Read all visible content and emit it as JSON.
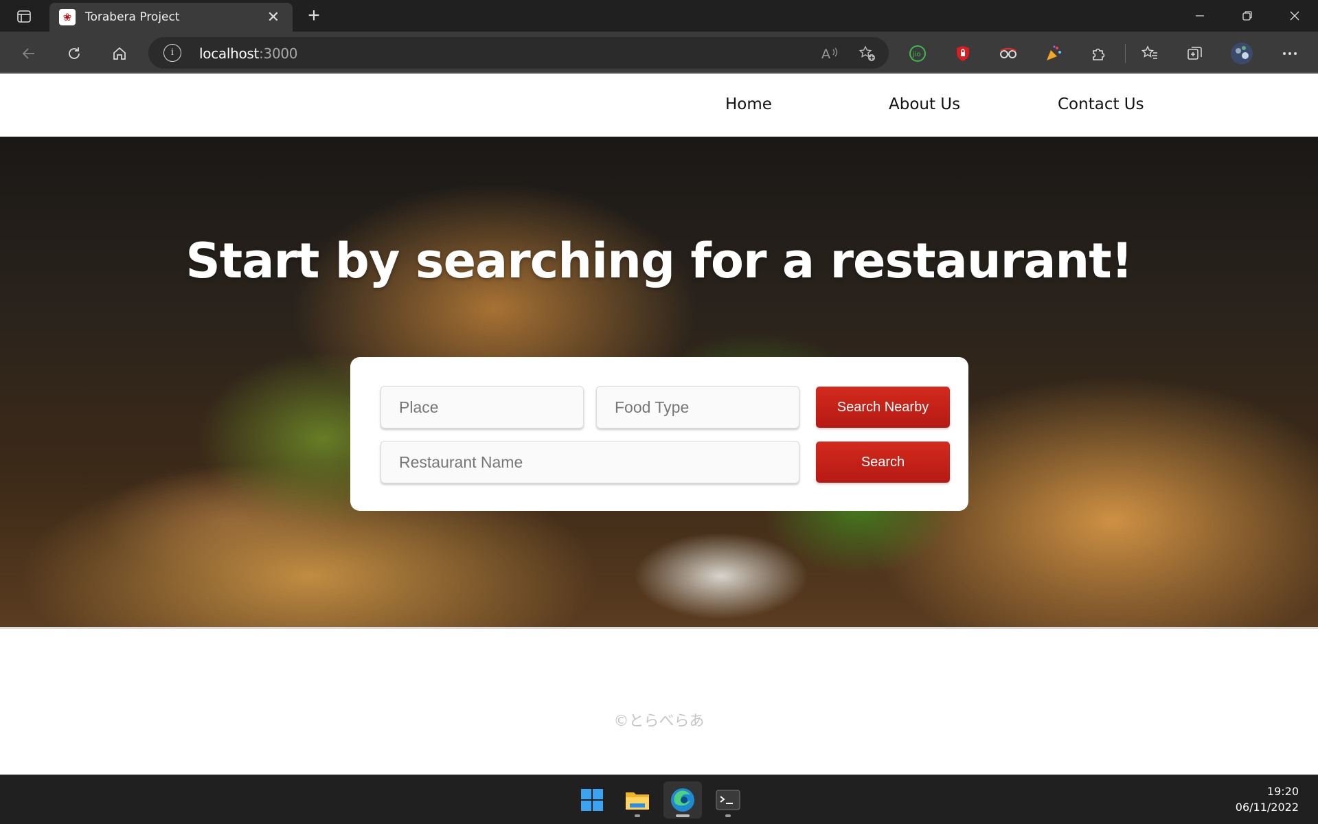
{
  "browser": {
    "tab_title": "Torabera Project",
    "tab_close": "✕",
    "new_tab": "+",
    "url_host": "localhost",
    "url_port": ":3000"
  },
  "site": {
    "nav": [
      "Home",
      "About Us",
      "Contact Us"
    ],
    "hero_title": "Start by searching for a restaurant!",
    "search": {
      "place_placeholder": "Place",
      "food_type_placeholder": "Food Type",
      "restaurant_name_placeholder": "Restaurant Name",
      "search_nearby_label": "Search Nearby",
      "search_label": "Search"
    },
    "footer": "©とらべらあ"
  },
  "taskbar": {
    "time": "19:20",
    "date": "06/11/2022"
  },
  "colors": {
    "accent_red": "#c8231a",
    "chrome_dark": "#202020",
    "chrome_toolbar": "#3b3b3b"
  }
}
